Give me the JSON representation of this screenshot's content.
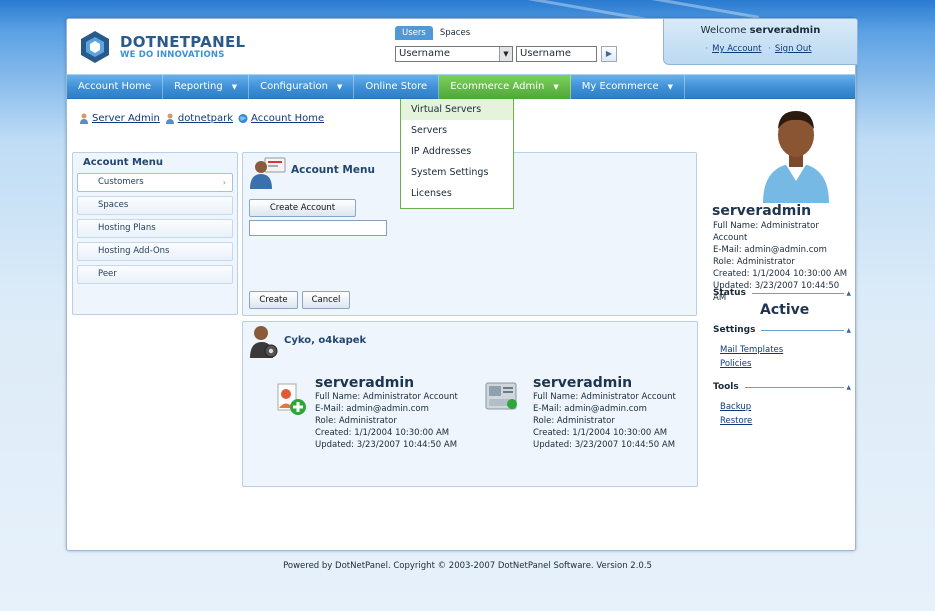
{
  "logo": {
    "title": "DOTNETPANEL",
    "tagline": "WE DO INNOVATIONS"
  },
  "search": {
    "tabs": [
      {
        "label": "Users",
        "active": true
      },
      {
        "label": "Spaces",
        "active": false
      }
    ],
    "field_select": "Username",
    "query_value": "Username",
    "go_icon": "arrow-right-icon"
  },
  "welcome": {
    "prefix": "Welcome",
    "user": "serveradmin",
    "my_account": "My Account",
    "sign_out": "Sign Out"
  },
  "nav": {
    "items": [
      {
        "label": "Account Home",
        "has_arrow": false
      },
      {
        "label": "Reporting",
        "has_arrow": true
      },
      {
        "label": "Configuration",
        "has_arrow": true
      },
      {
        "label": "Online Store",
        "has_arrow": false
      },
      {
        "label": "Ecommerce Admin",
        "has_arrow": true,
        "active": true
      },
      {
        "label": "My Ecommerce",
        "has_arrow": true
      }
    ],
    "dropdown": [
      "Virtual Servers",
      "Servers",
      "IP Addresses",
      "System Settings",
      "Licenses"
    ]
  },
  "breadcrumb": [
    "Server Admin",
    "dotnetpark",
    "Account Home"
  ],
  "account_menu": {
    "title": "Account Menu",
    "items": [
      "Customers",
      "Spaces",
      "Hosting Plans",
      "Hosting Add-Ons",
      "Peer"
    ]
  },
  "account_panel": {
    "title": "Account Menu",
    "create_account": "Create Account",
    "input_value": "",
    "create": "Create",
    "cancel": "Cancel"
  },
  "users_panel": {
    "title": "Cyko, o4kapek",
    "cards": [
      {
        "name": "serveradmin",
        "full_name": "Full Name: Administrator Account",
        "email": "E-Mail: admin@admin.com",
        "role": "Role: Administrator",
        "created": "Created: 1/1/2004 10:30:00 AM",
        "updated": "Updated: 3/23/2007 10:44:50 AM"
      },
      {
        "name": "serveradmin",
        "full_name": "Full Name: Administrator Account",
        "email": "E-Mail: admin@admin.com",
        "role": "Role: Administrator",
        "created": "Created: 1/1/2004 10:30:00 AM",
        "updated": "Updated: 3/23/2007 10:44:50 AM"
      }
    ]
  },
  "profile": {
    "name": "serveradmin",
    "full_name": "Full Name: Administrator Account",
    "email": "E-Mail: admin@admin.com",
    "role": "Role: Administrator",
    "created": "Created: 1/1/2004 10:30:00 AM",
    "updated": "Updated: 3/23/2007 10:44:50 AM"
  },
  "sidebar": {
    "status_label": "Status",
    "status_value": "Active",
    "settings_label": "Settings",
    "settings_links": [
      "Mail Templates",
      "Policies"
    ],
    "tools_label": "Tools",
    "tools_links": [
      "Backup",
      "Restore"
    ]
  },
  "footer": "Powered by DotNetPanel. Copyright © 2003-2007 DotNetPanel Software.  Version 2.0.5",
  "colors": {
    "nav_blue": "#3d8fd6",
    "nav_active_green": "#4ea63a",
    "link": "#0f3a78",
    "panel_bg": "#eef5fc"
  }
}
